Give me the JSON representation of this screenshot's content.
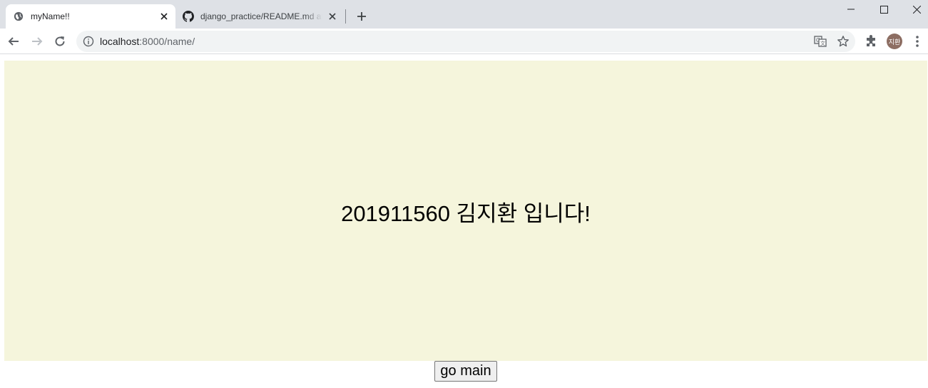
{
  "browser": {
    "tabs": [
      {
        "title": "myName!!",
        "icon": "globe-icon",
        "active": true
      },
      {
        "title": "django_practice/README.md at",
        "icon": "github-icon",
        "active": false
      }
    ],
    "address": {
      "host": "localhost",
      "path": ":8000/name/"
    },
    "profile": {
      "initials": "지환",
      "color": "#8d6e63"
    }
  },
  "page": {
    "headline": "201911560 김지환 입니다!",
    "button_label": "go main",
    "panel_color": "#f5f5dc"
  }
}
